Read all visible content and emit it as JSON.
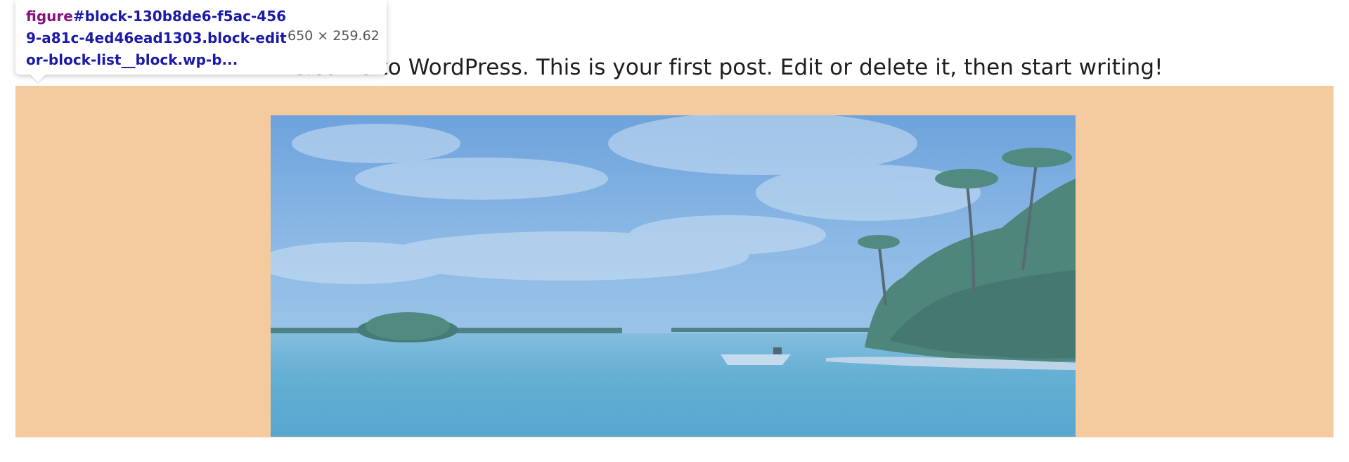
{
  "post": {
    "text": "Welcome to WordPress. This is your first post. Edit or delete it, then start writing!"
  },
  "devtools_tooltip": {
    "tag": "figure",
    "selector_rest": "#block-130b8de6-f5ac-4569-a81c-4ed46ead1303.block-editor-block-list__block.wp-b...",
    "dimensions": "650 × 259.62"
  },
  "figure": {
    "description_icon": "beach-photo",
    "highlight_colors": {
      "margin": "#f3cb9e",
      "content_overlay": "#6fa8dc"
    }
  }
}
